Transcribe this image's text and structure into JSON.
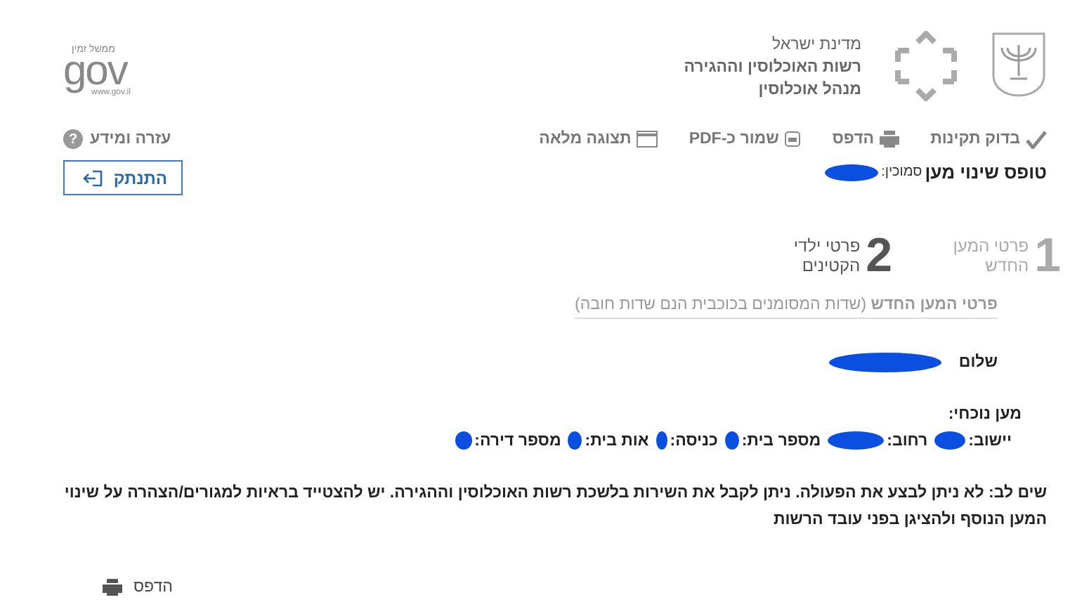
{
  "header": {
    "org_lines": [
      "מדינת ישראל",
      "רשות האוכלוסין וההגירה",
      "מנהל אוכלוסין"
    ],
    "gov_logo": {
      "tagline": "ממשל זמין",
      "word": "gov",
      "url": "www.gov.il"
    }
  },
  "toolbar": [
    {
      "kind": "check",
      "label": "בדוק תקינות"
    },
    {
      "kind": "print",
      "label": "הדפס"
    },
    {
      "kind": "pdf",
      "label": "שמור כ-PDF"
    },
    {
      "kind": "fullscreen",
      "label": "תצוגה מלאה"
    }
  ],
  "help": {
    "label": "עזרה ומידע",
    "icon_char": "?"
  },
  "form_title": "טופס שינוי מען",
  "reference_label": "סמוכין:",
  "logout_button": "התנתק",
  "steps": [
    {
      "number": "1",
      "label": "פרטי המען החדש",
      "selected": false
    },
    {
      "number": "2",
      "label": "פרטי ילדי הקטינים",
      "selected": true
    }
  ],
  "section_heading": "**פרטי המען החדש** (שדות המסומנים בכוכבית הנם שדות חובה)",
  "greeting": "שלום",
  "current_address": {
    "heading": "מען נוכחי:",
    "fields": [
      "יישוב:",
      "רחוב:",
      "מספר בית:",
      "כניסה:",
      "אות בית:",
      "מספר דירה:"
    ]
  },
  "notice": "שים לב: לא ניתן לבצע את הפעולה. ניתן לקבל את השירות בלשכת רשות האוכלוסין וההגירה. יש להצטייד בראיות למגורים/הצהרה על שינוי המען הנוסף ולהציגן בפני עובד הרשות",
  "print_link": "הדפס"
}
